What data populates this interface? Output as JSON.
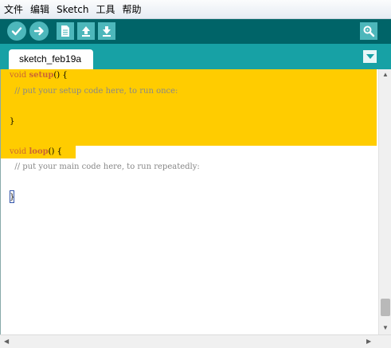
{
  "menu": [
    "文件",
    "编辑",
    "Sketch",
    "工具",
    "帮助"
  ],
  "toolbar": {
    "buttons": [
      "verify-icon",
      "upload-icon",
      "new-icon",
      "open-icon",
      "save-icon"
    ],
    "right_button": "serial-monitor-icon",
    "color_bg": "#006468",
    "color_button": "#4db7bb"
  },
  "tabs": {
    "active": "sketch_feb19a",
    "menu_button": "tab-menu-icon",
    "color_bg": "#17a1a5"
  },
  "editor": {
    "highlight_color": "#ffcc00",
    "line1": {
      "type": "void",
      "name": "setup",
      "rest": "() {"
    },
    "line2": "  // put your setup code here, to run once:",
    "line3": "}",
    "line4": {
      "type": "void",
      "name": "loop",
      "rest": "() {"
    },
    "line5": "  // put your main code here, to run repeatedly:",
    "line6": "}"
  }
}
